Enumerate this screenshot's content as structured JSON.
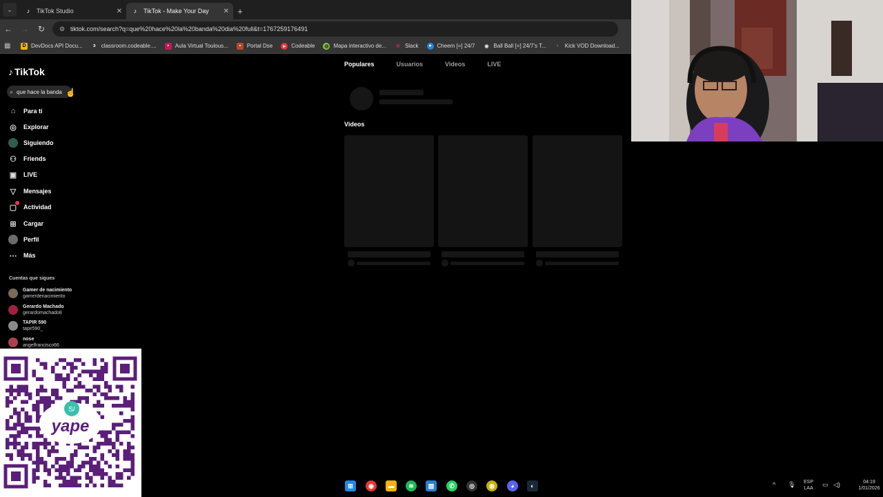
{
  "browser": {
    "tabs": [
      {
        "title": "TikTok Studio",
        "active": false
      },
      {
        "title": "TikTok - Make Your Day",
        "active": true
      }
    ],
    "new_tab": "+",
    "url": "tiktok.com/search?q=que%20hace%20la%20banda%20dia%20full&t=1767259176491",
    "bookmarks": [
      {
        "label": "DevDocs API Docu...",
        "color": "#f5b400"
      },
      {
        "label": "classroom.codeable....",
        "color": "#ffffff"
      },
      {
        "label": "Aula Virtual Toulous...",
        "color": "#c2185b"
      },
      {
        "label": "Portal Dse",
        "color": "#b7472a"
      },
      {
        "label": "Codeable",
        "color": "#e53935"
      },
      {
        "label": "Mapa interactivo de...",
        "color": "#8bc34a"
      },
      {
        "label": "Slack",
        "color": "#e01e5a"
      },
      {
        "label": "Cheem [=] 24/7",
        "color": "#1e88e5"
      },
      {
        "label": "Ball Ball [=] 24/7's T...",
        "color": "#dddddd"
      },
      {
        "label": "Kick VOD Download...",
        "color": "#7e57c2"
      }
    ]
  },
  "tiktok": {
    "logo": "TikTok",
    "search_value": "que hace la banda",
    "nav": [
      {
        "label": "Para ti",
        "icon": "home-icon"
      },
      {
        "label": "Explorar",
        "icon": "compass-icon"
      },
      {
        "label": "Siguiendo",
        "icon": "following-icon"
      },
      {
        "label": "Friends",
        "icon": "friends-icon"
      },
      {
        "label": "LIVE",
        "icon": "live-icon"
      },
      {
        "label": "Mensajes",
        "icon": "send-icon"
      },
      {
        "label": "Actividad",
        "icon": "activity-icon"
      },
      {
        "label": "Cargar",
        "icon": "upload-icon"
      },
      {
        "label": "Perfil",
        "icon": "profile-avatar"
      },
      {
        "label": "Más",
        "icon": "more-icon"
      }
    ],
    "following_title": "Cuentas que sigues",
    "following": [
      {
        "name": "Gamer de nacimiento",
        "user": "gamerdenacimiento",
        "color": "#7a6a5a"
      },
      {
        "name": "Gerardo Machado",
        "user": "gerardomachado8",
        "color": "#a02040"
      },
      {
        "name": "TAPIR 590",
        "user": "tapir590_",
        "color": "#8a8a8a"
      },
      {
        "name": "nose",
        "user": "angelfrancisco66",
        "color": "#b04050"
      }
    ]
  },
  "results": {
    "tabs": [
      "Populares",
      "Usuarios",
      "Videos",
      "LIVE"
    ],
    "videos_label": "Videos"
  },
  "qr": {
    "brand": "yape",
    "badge": "S/"
  },
  "taskbar": {
    "lang_top": "ESP",
    "lang_bottom": "LAA",
    "time": "04:19",
    "date": "1/01/2026"
  }
}
